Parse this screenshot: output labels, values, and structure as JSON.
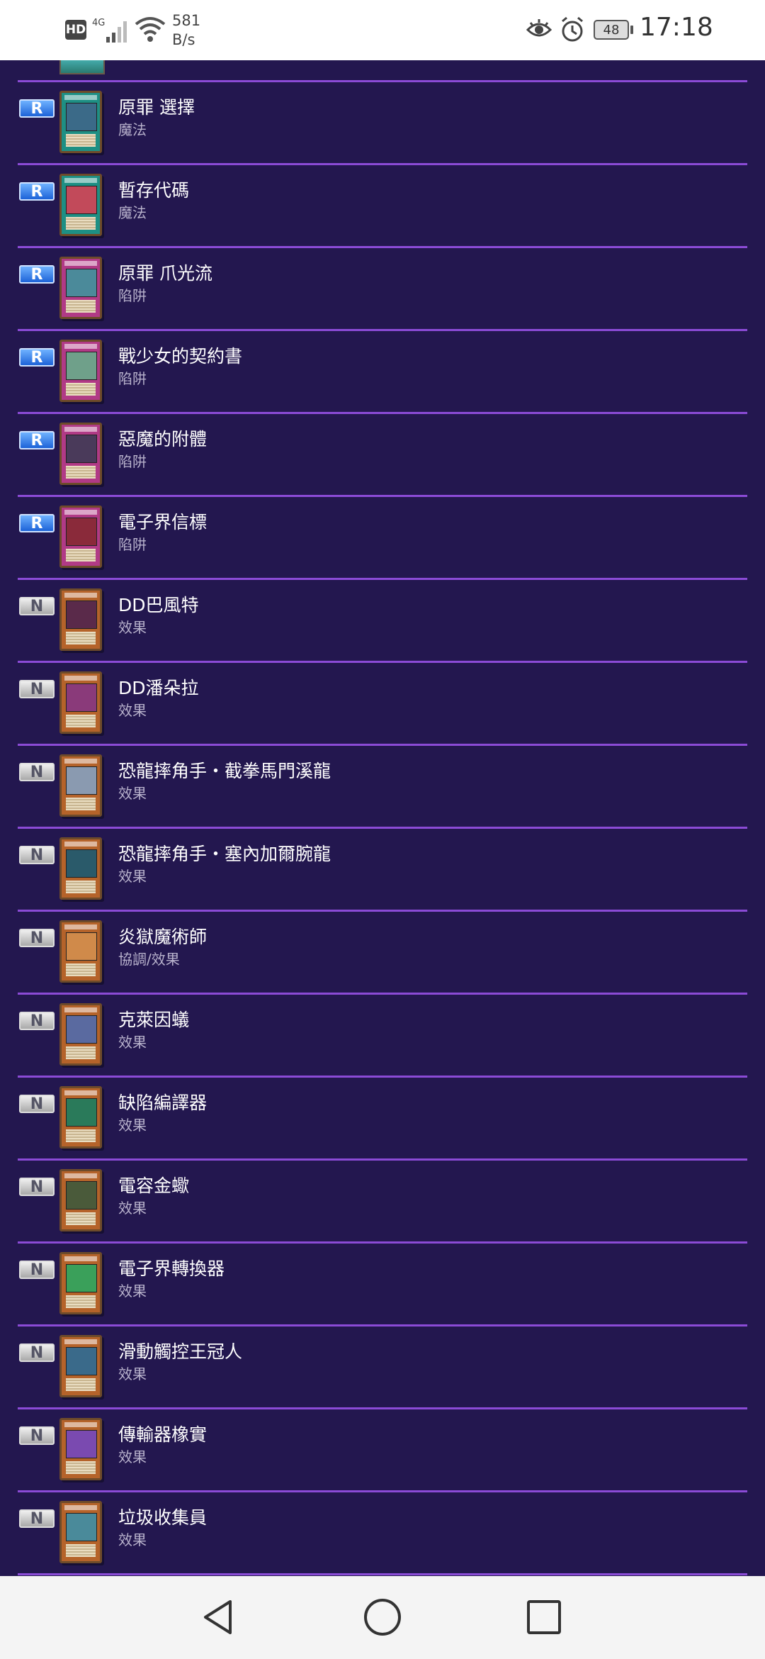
{
  "status_bar": {
    "hd": "HD",
    "network": "4G",
    "net_speed_value": "581",
    "net_speed_unit": "B/s",
    "battery": "48",
    "time": "17:18"
  },
  "cards": [
    {
      "rarity": "R",
      "name": "原罪 選擇",
      "type": "魔法",
      "frame": "spell",
      "art": "#3b6a88"
    },
    {
      "rarity": "R",
      "name": "暫存代碼",
      "type": "魔法",
      "frame": "spell",
      "art": "#c24a5a"
    },
    {
      "rarity": "R",
      "name": "原罪 爪光流",
      "type": "陷阱",
      "frame": "trap",
      "art": "#4b8a9a"
    },
    {
      "rarity": "R",
      "name": "戰少女的契約書",
      "type": "陷阱",
      "frame": "trap",
      "art": "#6fa08a"
    },
    {
      "rarity": "R",
      "name": "惡魔的附體",
      "type": "陷阱",
      "frame": "trap",
      "art": "#4a3a5a"
    },
    {
      "rarity": "R",
      "name": "電子界信標",
      "type": "陷阱",
      "frame": "trap",
      "art": "#8a2a3a"
    },
    {
      "rarity": "N",
      "name": "DD巴風特",
      "type": "效果",
      "frame": "effect",
      "art": "#5a2a4a"
    },
    {
      "rarity": "N",
      "name": "DD潘朵拉",
      "type": "效果",
      "frame": "effect",
      "art": "#8a3a7a"
    },
    {
      "rarity": "N",
      "name": "恐龍摔角手・截拳馬門溪龍",
      "type": "效果",
      "frame": "effect",
      "art": "#8a9ab0"
    },
    {
      "rarity": "N",
      "name": "恐龍摔角手・塞內加爾腕龍",
      "type": "效果",
      "frame": "effect",
      "art": "#2a5a6a"
    },
    {
      "rarity": "N",
      "name": "炎獄魔術師",
      "type": "協調/效果",
      "frame": "effect",
      "art": "#d08a4a"
    },
    {
      "rarity": "N",
      "name": "克萊因蟻",
      "type": "效果",
      "frame": "effect",
      "art": "#5a6aa0"
    },
    {
      "rarity": "N",
      "name": "缺陷編譯器",
      "type": "效果",
      "frame": "effect",
      "art": "#2a7a5a"
    },
    {
      "rarity": "N",
      "name": "電容金蠍",
      "type": "效果",
      "frame": "effect",
      "art": "#4a5a3a"
    },
    {
      "rarity": "N",
      "name": "電子界轉換器",
      "type": "效果",
      "frame": "effect",
      "art": "#3aa05a"
    },
    {
      "rarity": "N",
      "name": "滑動觸控王冠人",
      "type": "效果",
      "frame": "effect",
      "art": "#3a6a8a"
    },
    {
      "rarity": "N",
      "name": "傳輸器橡實",
      "type": "效果",
      "frame": "effect",
      "art": "#7a4ab0"
    },
    {
      "rarity": "N",
      "name": "垃圾收集員",
      "type": "效果",
      "frame": "effect",
      "art": "#4a8a9a"
    }
  ],
  "nav": [
    "back-icon",
    "home-icon",
    "recents-icon"
  ]
}
